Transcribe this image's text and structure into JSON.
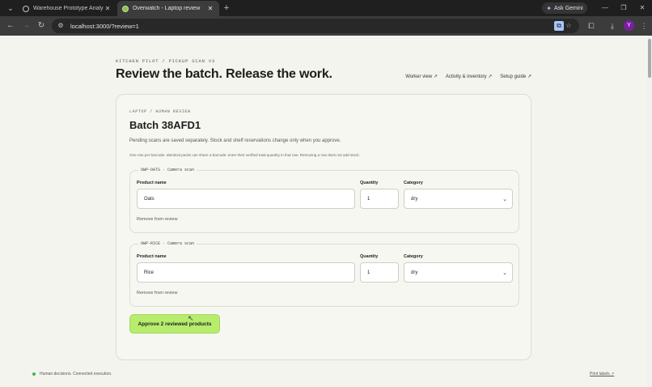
{
  "browser": {
    "tabs": [
      {
        "title": "Warehouse Prototype Analysis",
        "active": false
      },
      {
        "title": "Overwatch - Laptop review",
        "active": true
      }
    ],
    "gemini_label": "Ask Gemini",
    "url": "localhost:3000/?review=1",
    "profile_initial": "Y",
    "icons": {
      "tab_search": "chevron-down-icon",
      "new_tab": "plus-icon",
      "back": "back-arrow-icon",
      "forward": "forward-arrow-icon",
      "reload": "reload-icon",
      "site_info": "site-info-icon",
      "install": "install-app-icon",
      "bookmark": "star-icon",
      "extensions": "puzzle-icon",
      "downloads": "download-icon",
      "menu": "kebab-menu-icon"
    }
  },
  "header": {
    "eyebrow": "KITCHEN PILOT / PICKUP SCAN V3",
    "title": "Review the batch. Release the work.",
    "links": [
      "Worker view ↗",
      "Activity & inventory ↗",
      "Setup guide ↗"
    ]
  },
  "card": {
    "eyebrow": "LAPTOP / HUMAN REVIEW",
    "title": "Batch 38AFD1",
    "lead": "Pending scans are saved separately. Stock and shelf reservations change only when you approve.",
    "note": "One row per barcode. Identical packs can share a barcode: enter their verified total quantity in that row. Removing a row does not add stock.",
    "field_labels": {
      "name": "Product name",
      "quantity": "Quantity",
      "category": "Category"
    },
    "products": [
      {
        "legend": "OWP-OATS · Camera scan",
        "name": "Oats",
        "quantity": "1",
        "category": "dry",
        "remove_label": "Remove from review"
      },
      {
        "legend": "OWP-RICE · Camera scan",
        "name": "Rice",
        "quantity": "1",
        "category": "dry",
        "remove_label": "Remove from review"
      }
    ],
    "approve_label": "Approve 2 reviewed products"
  },
  "footer": {
    "status": "Human decisions. Connected execution.",
    "link": "Print labels ↗"
  },
  "colors": {
    "accent": "#b7ec6e",
    "page_bg": "#f4f4ee",
    "status_dot": "#4caf50"
  }
}
